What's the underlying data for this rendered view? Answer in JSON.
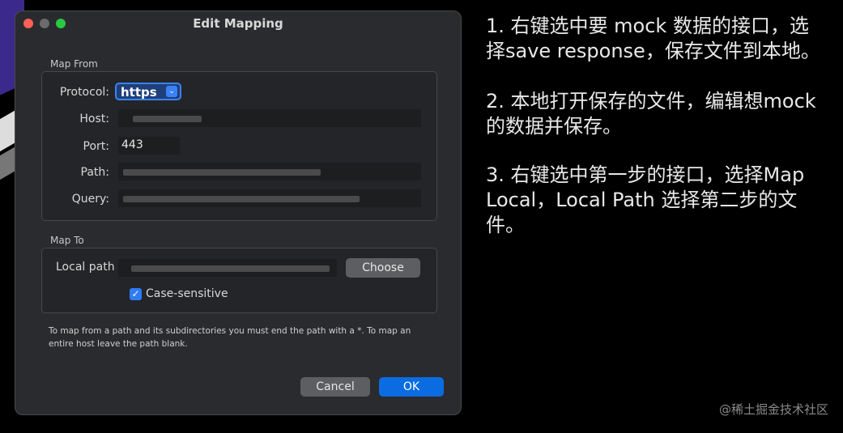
{
  "window": {
    "title": "Edit Mapping"
  },
  "map_from": {
    "section_label": "Map From",
    "protocol": {
      "label": "Protocol:",
      "value": "https"
    },
    "host": {
      "label": "Host:"
    },
    "port": {
      "label": "Port:",
      "value": "443"
    },
    "path": {
      "label": "Path:"
    },
    "query": {
      "label": "Query:"
    }
  },
  "map_to": {
    "section_label": "Map To",
    "local_path": {
      "label": "Local path"
    },
    "choose_label": "Choose",
    "case_sensitive": {
      "label": "Case-sensitive",
      "checked": true
    }
  },
  "hint": "To map from a path and its subdirectories you must end the path with a *. To map an entire host leave the path blank.",
  "buttons": {
    "cancel": "Cancel",
    "ok": "OK"
  },
  "instructions": [
    "1. 右键选中要 mock 数据的接口，选择save response，保存文件到本地。",
    "2. 本地打开保存的文件，编辑想mock 的数据并保存。",
    "3. 右键选中第一步的接口，选择Map Local，Local Path 选择第二步的文件。"
  ],
  "watermark": "@稀土掘金技术社区"
}
